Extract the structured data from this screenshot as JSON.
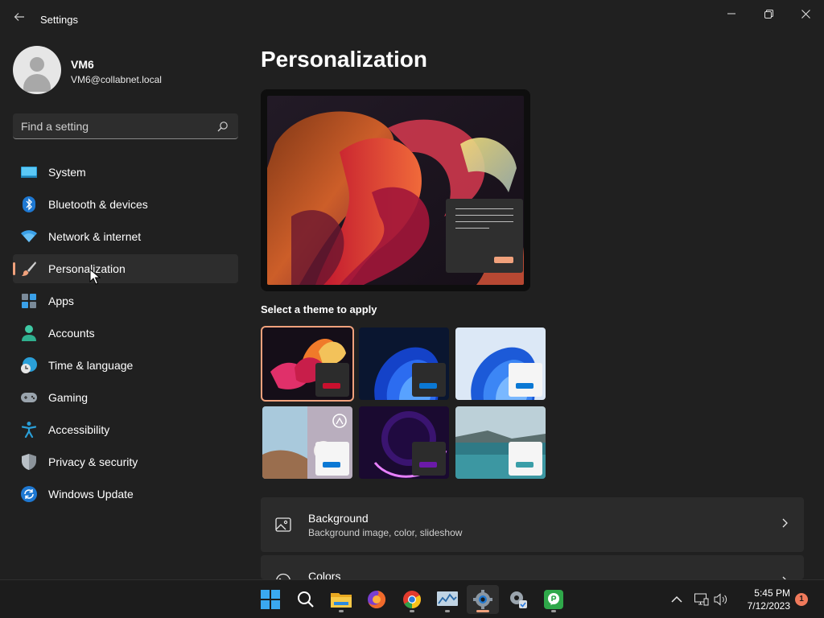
{
  "window": {
    "app_title": "Settings",
    "back_icon": "back-arrow-icon",
    "controls": [
      "minimize",
      "maximize",
      "close"
    ]
  },
  "profile": {
    "name": "VM6",
    "email": "VM6@collabnet.local"
  },
  "search": {
    "placeholder": "Find a setting"
  },
  "sidebar": {
    "items": [
      {
        "label": "System",
        "icon": "system-icon",
        "selected": false
      },
      {
        "label": "Bluetooth & devices",
        "icon": "bluetooth-icon",
        "selected": false
      },
      {
        "label": "Network & internet",
        "icon": "wifi-icon",
        "selected": false
      },
      {
        "label": "Personalization",
        "icon": "brush-icon",
        "selected": true
      },
      {
        "label": "Apps",
        "icon": "apps-icon",
        "selected": false
      },
      {
        "label": "Accounts",
        "icon": "accounts-icon",
        "selected": false
      },
      {
        "label": "Time & language",
        "icon": "clock-globe-icon",
        "selected": false
      },
      {
        "label": "Gaming",
        "icon": "gamepad-icon",
        "selected": false
      },
      {
        "label": "Accessibility",
        "icon": "accessibility-icon",
        "selected": false
      },
      {
        "label": "Privacy & security",
        "icon": "shield-icon",
        "selected": false
      },
      {
        "label": "Windows Update",
        "icon": "update-icon",
        "selected": false
      }
    ]
  },
  "main": {
    "title": "Personalization",
    "themes_label": "Select a theme to apply",
    "themes": [
      {
        "name": "theme-glow",
        "selected": true,
        "accent": "#c8102e"
      },
      {
        "name": "theme-windows-dark",
        "selected": false,
        "accent": "#0a78d4"
      },
      {
        "name": "theme-windows-light",
        "selected": false,
        "accent": "#0a78d4"
      },
      {
        "name": "theme-spotlight",
        "selected": false,
        "accent": "#0a78d4"
      },
      {
        "name": "theme-captured-motion",
        "selected": false,
        "accent": "#6b1aa8"
      },
      {
        "name": "theme-flow",
        "selected": false,
        "accent": "#3a9ea8"
      }
    ],
    "cards": [
      {
        "title": "Background",
        "subtitle": "Background image, color, slideshow",
        "icon": "image-icon"
      },
      {
        "title": "Colors",
        "subtitle": "",
        "icon": "palette-icon"
      }
    ]
  },
  "taskbar": {
    "apps": [
      {
        "name": "start",
        "icon": "windows-logo-icon",
        "active": false,
        "running": false
      },
      {
        "name": "search",
        "icon": "search-icon",
        "active": false,
        "running": false
      },
      {
        "name": "file-explorer",
        "icon": "folder-icon",
        "active": false,
        "running": true
      },
      {
        "name": "firefox",
        "icon": "firefox-icon",
        "active": false,
        "running": false
      },
      {
        "name": "chrome",
        "icon": "chrome-icon",
        "active": false,
        "running": true
      },
      {
        "name": "task-manager",
        "icon": "task-manager-icon",
        "active": false,
        "running": true
      },
      {
        "name": "settings",
        "icon": "gear-icon",
        "active": true,
        "running": true
      },
      {
        "name": "settings-admin",
        "icon": "gear-check-icon",
        "active": false,
        "running": false
      },
      {
        "name": "teamviewer-chat",
        "icon": "chat-icon",
        "active": false,
        "running": true
      }
    ],
    "clock": {
      "time": "5:45 PM",
      "date": "7/12/2023"
    },
    "notification_count": "1"
  },
  "colors": {
    "accent": "#f0a17c",
    "background": "#202020",
    "card": "#2b2b2b"
  }
}
